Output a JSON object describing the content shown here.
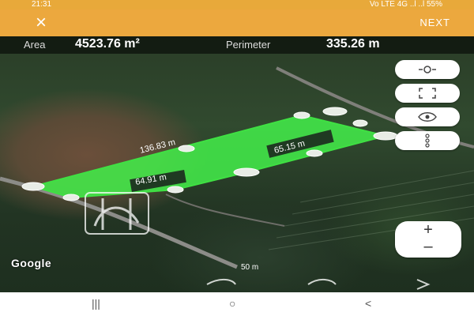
{
  "status": {
    "time": "21:31",
    "right": "Vo LTE 4G ..l ..l 55%"
  },
  "topbar": {
    "close_label": "×",
    "next_label": "NEXT"
  },
  "info": {
    "area_label": "Area",
    "area_value": "4523.76 m²",
    "perimeter_label": "Perimeter",
    "perimeter_value": "335.26 m"
  },
  "measurements": {
    "top_side": "136.83 m",
    "right_side": "65.15 m",
    "bottom_side": "64.91 m"
  },
  "map": {
    "attribution": "Google",
    "scale_label": "50 m"
  },
  "icons": {
    "locate": "crosshair-icon",
    "fullscreen": "fullscreen-icon",
    "eye": "eye-icon",
    "more": "more-vertical-icon",
    "close": "close-icon"
  },
  "navbar": {
    "recents": "|||",
    "home": "○",
    "back": "<"
  }
}
